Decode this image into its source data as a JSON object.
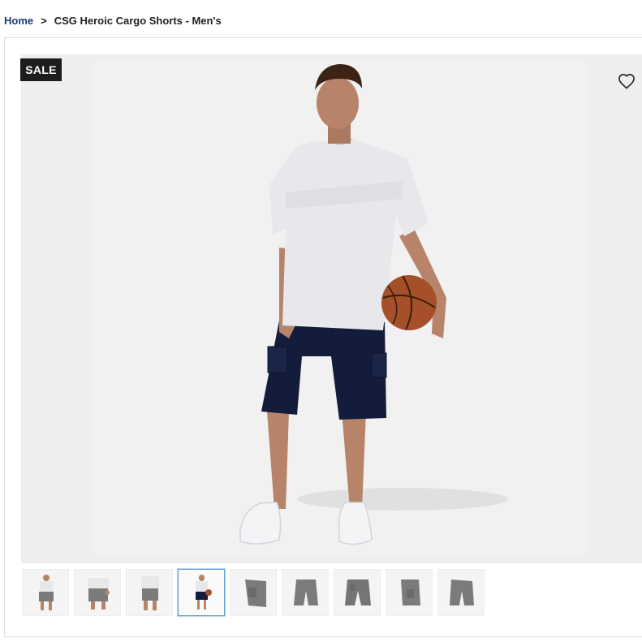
{
  "breadcrumb": {
    "home": "Home",
    "separator": ">",
    "current": "CSG Heroic Cargo Shorts - Men's"
  },
  "badge": {
    "label": "SALE"
  },
  "icons": {
    "wishlist": "heart-outline-icon"
  },
  "colors": {
    "home_link": "#1a3a7a",
    "badge_bg": "#1d1d1d",
    "selected_thumb_border": "#5b9ee6",
    "shorts_navy": "#131c3a",
    "shorts_grey": "#7b7b7b"
  },
  "thumbnails": [
    {
      "view": "model-front-grey",
      "selected": false
    },
    {
      "view": "model-hand-grey",
      "selected": false
    },
    {
      "view": "model-back-grey",
      "selected": false
    },
    {
      "view": "model-full-navy",
      "selected": true
    },
    {
      "view": "detail-pocket-grey",
      "selected": false
    },
    {
      "view": "flat-front-grey",
      "selected": false
    },
    {
      "view": "flat-back-grey",
      "selected": false
    },
    {
      "view": "flat-side-grey",
      "selected": false
    },
    {
      "view": "flat-angle-grey",
      "selected": false
    }
  ]
}
